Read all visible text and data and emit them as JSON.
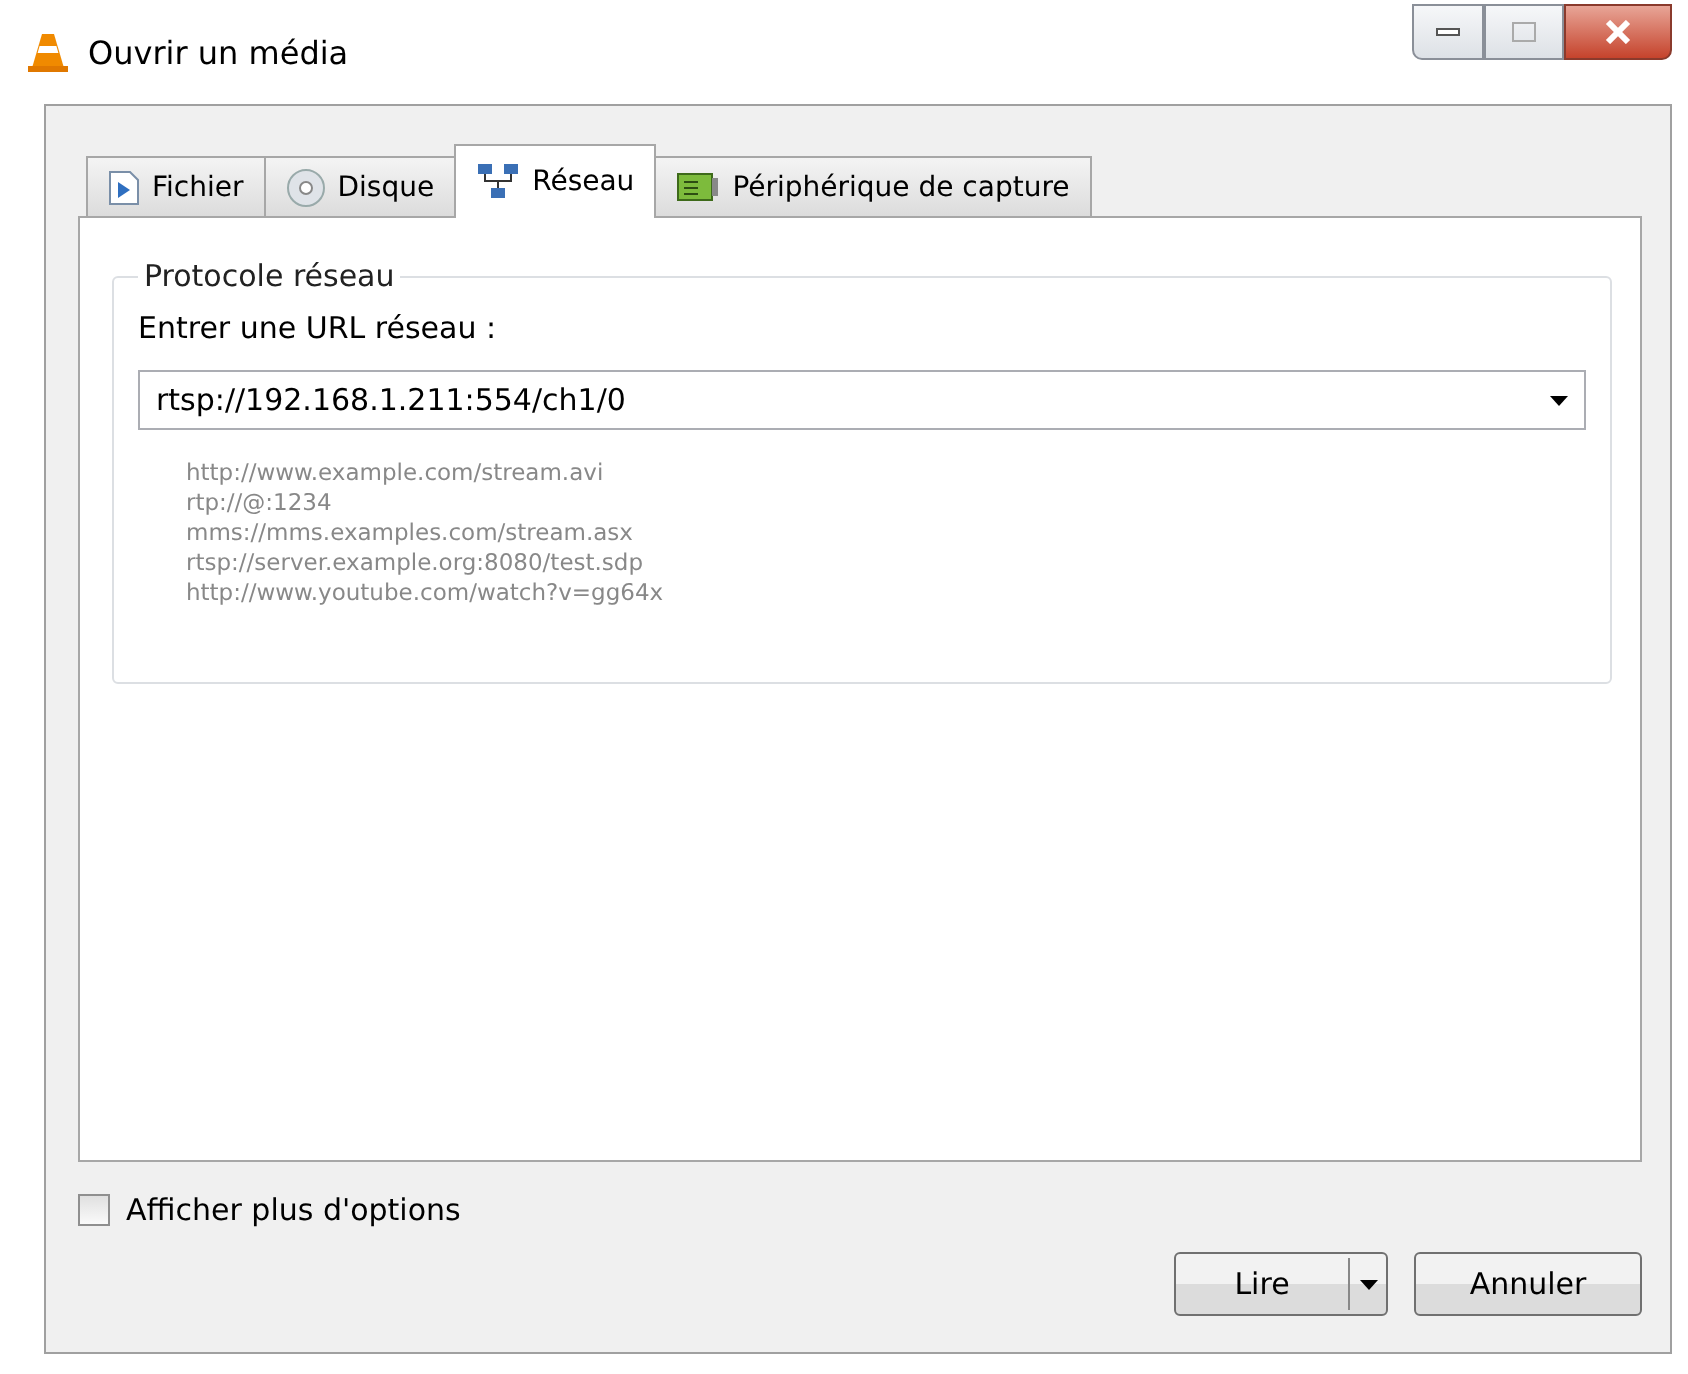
{
  "window": {
    "title": "Ouvrir un média"
  },
  "tabs": [
    {
      "label": "Fichier",
      "selected": false
    },
    {
      "label": "Disque",
      "selected": false
    },
    {
      "label": "Réseau",
      "selected": true
    },
    {
      "label": "Périphérique de capture",
      "selected": false
    }
  ],
  "group": {
    "title": "Protocole réseau",
    "field_label": "Entrer une URL réseau :",
    "url": {
      "value": "rtsp://192.168.1.211:554/ch1/0"
    },
    "examples": [
      "http://www.example.com/stream.avi",
      "rtp://@:1234",
      "mms://mms.examples.com/stream.asx",
      "rtsp://server.example.org:8080/test.sdp",
      "http://www.youtube.com/watch?v=gg64x"
    ]
  },
  "more_options": {
    "label": "Afficher plus d'options",
    "checked": false
  },
  "buttons": [
    {
      "label": "Lire",
      "kind": "split"
    },
    {
      "label": "Annuler",
      "kind": "plain"
    }
  ]
}
